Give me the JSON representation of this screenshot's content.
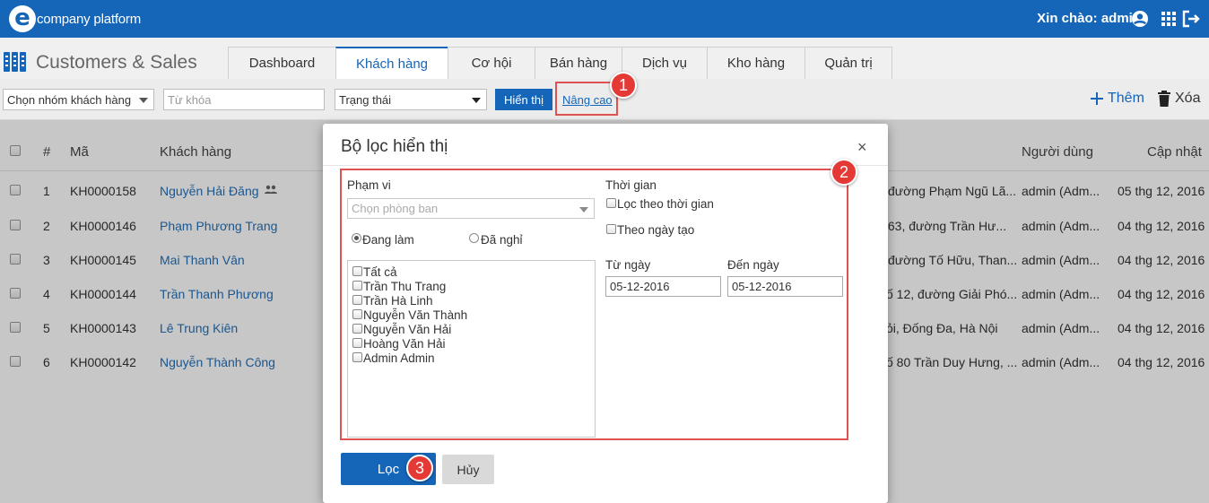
{
  "header": {
    "logo_letter": "e",
    "logo_text": "company platform",
    "greeting": "Xin chào: admin",
    "colors": {
      "brand": "#1565b8",
      "accent_red": "#e53935"
    }
  },
  "module": {
    "title": "Customers & Sales",
    "tabs": [
      {
        "label": "Dashboard"
      },
      {
        "label": "Khách hàng"
      },
      {
        "label": "Cơ hội"
      },
      {
        "label": "Bán hàng"
      },
      {
        "label": "Dịch vụ"
      },
      {
        "label": "Kho hàng"
      },
      {
        "label": "Quản trị"
      }
    ]
  },
  "toolbar": {
    "group_select": "Chọn nhóm khách hàng",
    "keyword_placeholder": "Từ khóa",
    "status_select": "Trạng thái",
    "show_button": "Hiển thị",
    "advanced_link": "Nâng cao",
    "add_label": "Thêm",
    "delete_label": "Xóa"
  },
  "callouts": [
    "1",
    "2",
    "3"
  ],
  "table": {
    "headers": {
      "num": "#",
      "code": "Mã",
      "customer": "Khách hàng",
      "user": "Người dùng",
      "updated": "Cập nhật"
    },
    "rows": [
      {
        "num": "1",
        "code": "KH0000158",
        "name": "Nguyễn Hải Đăng",
        "address": "đường Phạm Ngũ Lã...",
        "user": "admin (Adm...",
        "updated": "05 thg 12, 2016"
      },
      {
        "num": "2",
        "code": "KH0000146",
        "name": "Phạm Phương Trang",
        "address": "/63, đường Trần Hư...",
        "user": "admin (Adm...",
        "updated": "04 thg 12, 2016"
      },
      {
        "num": "3",
        "code": "KH0000145",
        "name": "Mai Thanh Vân",
        "address": "đường Tố Hữu, Than...",
        "user": "admin (Adm...",
        "updated": "04 thg 12, 2016"
      },
      {
        "num": "4",
        "code": "KH0000144",
        "name": "Trần Thanh Phương",
        "address": "ố 12, đường Giải Phó...",
        "user": "admin (Adm...",
        "updated": "04 thg 12, 2016"
      },
      {
        "num": "5",
        "code": "KH0000143",
        "name": "Lê Trung Kiên",
        "address": "ỏi, Đống Đa, Hà Nội",
        "user": "admin (Adm...",
        "updated": "04 thg 12, 2016"
      },
      {
        "num": "6",
        "code": "KH0000142",
        "name": "Nguyễn Thành Công",
        "address": "ố 80 Trần Duy Hưng, ...",
        "user": "admin (Adm...",
        "updated": "04 thg 12, 2016"
      }
    ]
  },
  "modal": {
    "title": "Bộ lọc hiển thị",
    "close": "×",
    "scope_label": "Phạm vi",
    "dept_placeholder": "Chọn phòng ban",
    "radio_working": "Đang làm",
    "radio_quit": "Đã nghỉ",
    "users": [
      "Tất cả",
      "Trần Thu Trang",
      "Trần Hà Linh",
      "Nguyễn Văn Thành",
      "Nguyễn Văn Hải",
      "Hoàng Văn Hải",
      "Admin Admin"
    ],
    "time_label": "Thời gian",
    "filter_by_time": "Lọc theo thời gian",
    "by_created_date": "Theo ngày tạo",
    "from_label": "Từ ngày",
    "to_label": "Đến ngày",
    "from_value": "05-12-2016",
    "to_value": "05-12-2016",
    "filter_button": "Lọc",
    "cancel_button": "Hủy"
  }
}
